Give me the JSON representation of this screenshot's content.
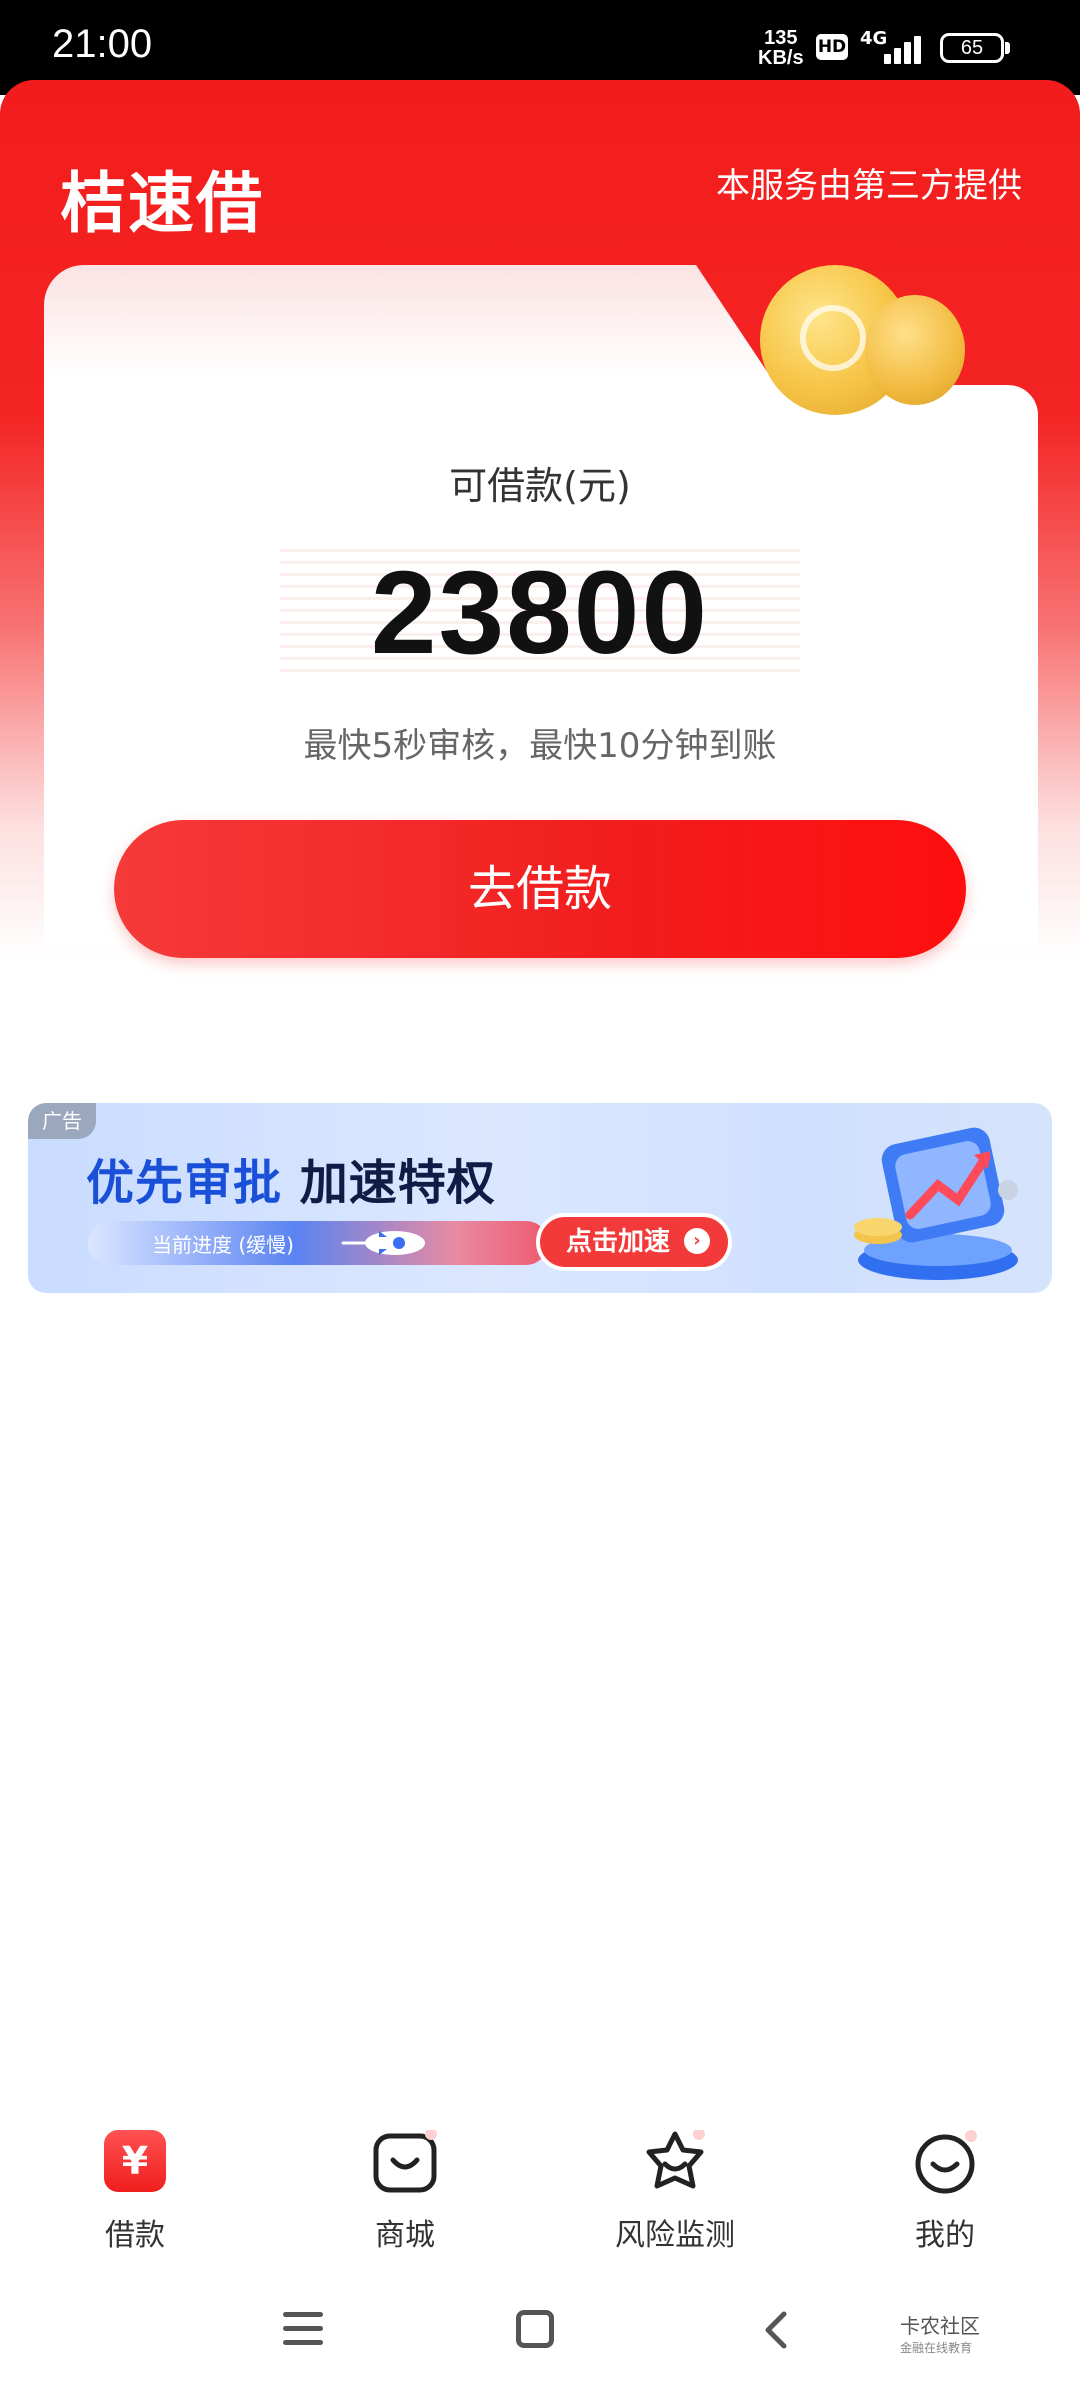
{
  "status_bar": {
    "time": "21:00",
    "speed_value": "135",
    "speed_unit": "KB/s",
    "hd": "HD",
    "network": "4G",
    "battery": "65"
  },
  "header": {
    "brand": "桔速借",
    "provider_note": "本服务由第三方提供"
  },
  "loan_card": {
    "available_label": "可借款(元)",
    "amount": "23800",
    "note": "最快5秒审核，最快10分钟到账",
    "borrow_button": "去借款"
  },
  "ad_banner": {
    "tag": "广告",
    "title_part1": "优先审批",
    "title_part2": "加速特权",
    "progress_label": "当前进度 (缓慢)",
    "cta": "点击加速",
    "cta_arrow": "›"
  },
  "bottom_nav": {
    "items": [
      {
        "label": "借款",
        "icon": "yuan-icon",
        "active": true
      },
      {
        "label": "商城",
        "icon": "shop-bag-icon",
        "active": false
      },
      {
        "label": "风险监测",
        "icon": "star-shield-icon",
        "active": false
      },
      {
        "label": "我的",
        "icon": "profile-face-icon",
        "active": false
      }
    ],
    "loan_glyph": "¥"
  },
  "watermark": {
    "title": "卡农社区",
    "subtitle": "金融在线教育"
  },
  "colors": {
    "primary_red": "#f21d1d",
    "ad_blue": "#1a4fd8"
  }
}
